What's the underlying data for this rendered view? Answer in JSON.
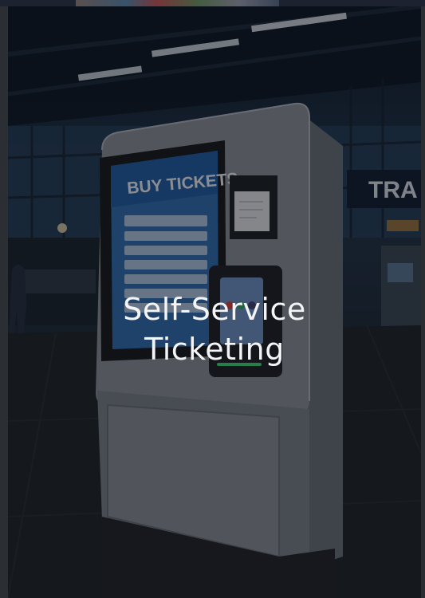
{
  "hero": {
    "title_line1": "Self-Service",
    "title_line2": "Ticketing",
    "kiosk_screen_heading": "BUY TICKETS",
    "station_sign_text": "TRA"
  },
  "colors": {
    "overlay": "#0a0c10",
    "title_text": "#f2f4f6",
    "kiosk_screen": "#2f6fb5",
    "card_reader_light": "#3ddc7a"
  }
}
